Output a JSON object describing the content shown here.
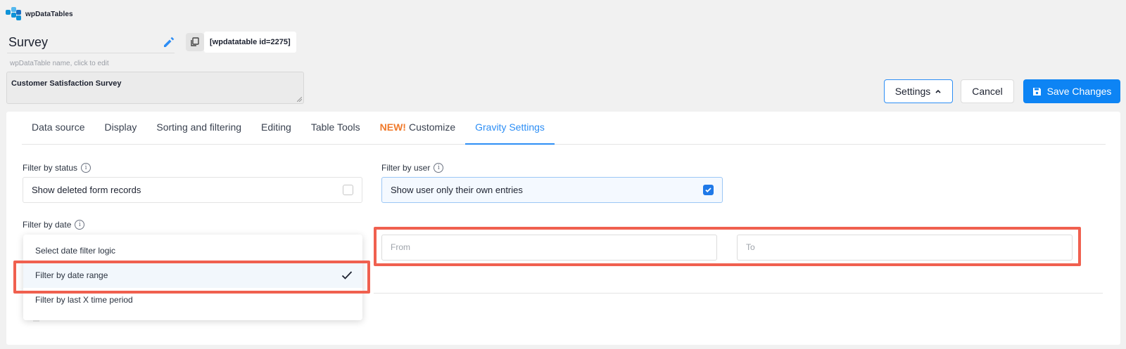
{
  "app": {
    "brand": "wpDataTables",
    "logo_icon": "wpdatatables-logo-icon"
  },
  "header": {
    "table_name": "Survey",
    "table_name_hint": "wpDataTable name, click to edit",
    "shortcode": "[wpdatatable id=2275]",
    "description": "Customer Satisfaction Survey",
    "buttons": {
      "settings": "Settings",
      "cancel": "Cancel",
      "save": "Save Changes"
    }
  },
  "tabs": [
    {
      "label": "Data source"
    },
    {
      "label": "Display"
    },
    {
      "label": "Sorting and filtering"
    },
    {
      "label": "Editing"
    },
    {
      "label": "Table Tools"
    },
    {
      "badge": "NEW!",
      "label": "Customize"
    },
    {
      "label": "Gravity Settings",
      "active": true
    }
  ],
  "filters": {
    "status": {
      "label": "Filter by status",
      "option": "Show deleted form records",
      "checked": false
    },
    "user": {
      "label": "Filter by user",
      "option": "Show user only their own entries",
      "checked": true
    },
    "date": {
      "label": "Filter by date",
      "from_placeholder": "From",
      "to_placeholder": "To",
      "options": [
        {
          "label": "Select date filter logic",
          "selected": false
        },
        {
          "label": "Filter by date range",
          "selected": true
        },
        {
          "label": "Filter by last X time period",
          "selected": false
        }
      ]
    }
  },
  "colors": {
    "accent": "#0d84f4",
    "highlight": "#f0604f",
    "new_badge": "#f07a2b"
  }
}
